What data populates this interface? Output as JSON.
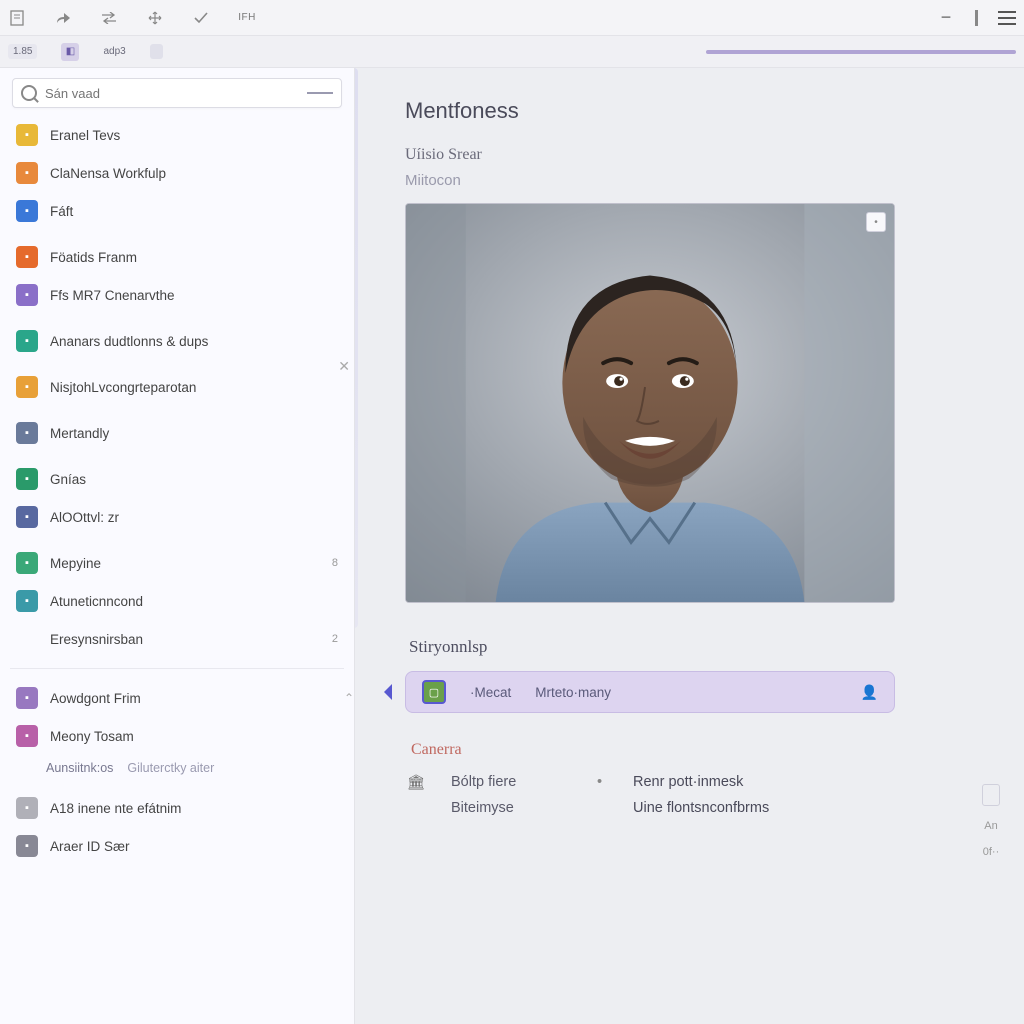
{
  "toolbar": {
    "icons": [
      "doc",
      "share",
      "swap",
      "move",
      "check",
      "code"
    ],
    "code_label": "IFH",
    "right": [
      "minus",
      "bar",
      "menu"
    ]
  },
  "ribbon": {
    "chip": "1.85",
    "label": "adp3"
  },
  "search": {
    "placeholder": "Sán vaad"
  },
  "nav": [
    {
      "label": "Eranel Tevs",
      "color": "yellow"
    },
    {
      "label": "ClaNensa Workfulp",
      "color": "orange"
    },
    {
      "label": "Fáft",
      "color": "blue"
    },
    {
      "__gap": true
    },
    {
      "label": "Föatids Franm",
      "color": "orange2"
    },
    {
      "label": "Ffs MR7 Cnenarvthe",
      "color": "purple"
    },
    {
      "__gap": true
    },
    {
      "label": "Ananars dudtlonns & dups",
      "color": "teal",
      "close_after": true
    },
    {
      "__gap": true
    },
    {
      "label": "NisjtohLvcongrteparotan",
      "color": "amber"
    },
    {
      "__gap": true
    },
    {
      "label": "Mertandly",
      "color": "slate"
    },
    {
      "__gap": true
    },
    {
      "label": "Gnías",
      "color": "green"
    },
    {
      "label": "AlOOttvl: zr",
      "color": "navy"
    },
    {
      "__gap": true
    },
    {
      "label": "Mepyine",
      "color": "green2",
      "badge": "8"
    },
    {
      "label": "Atuneticnncond",
      "color": "teal2"
    },
    {
      "label": "Eresynsnirsban",
      "color": "none",
      "badge": "2"
    }
  ],
  "nav2": [
    {
      "label": "Aowdgont Frim",
      "color": "purple2",
      "chev": true
    },
    {
      "label": "Meony Tosam",
      "color": "pink"
    }
  ],
  "nav2_sub": {
    "a": "Aunsiitnk:os",
    "b": "Giluterctky aiter"
  },
  "nav3": [
    {
      "label": "A18 inene nte efátnim",
      "color": "gray"
    },
    {
      "label": "Araer ID Sær",
      "color": "dark"
    }
  ],
  "profile": {
    "title": "Mentfoness",
    "name": "Uíisio Srear",
    "role": "Miitocon",
    "image_btn": "•"
  },
  "section_label": "Stiryonnlsp",
  "action_bar": {
    "a": "·Mecat",
    "b": "Mrteto·many"
  },
  "camera_heading": "Canerra",
  "grid": {
    "r1_k": "Bóltp fiere",
    "r1_v": "Renr pott·inmesk",
    "r2_k": "Biteimyse",
    "r2_v": "Uine flontsnconfbrms"
  },
  "right_floats": {
    "a": "An",
    "b": "0f··"
  }
}
